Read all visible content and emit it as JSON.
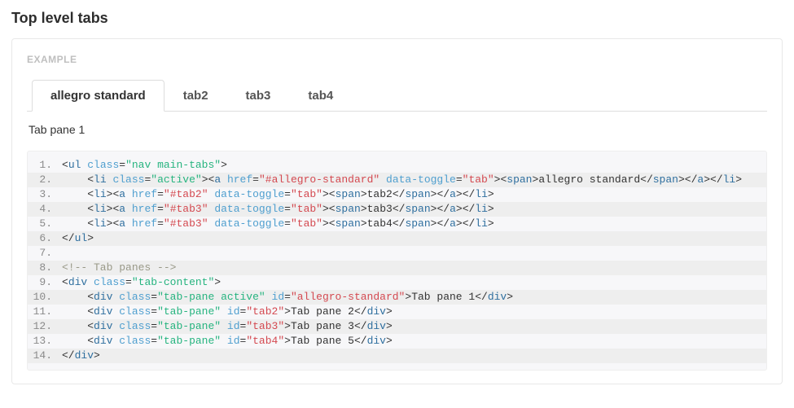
{
  "section": {
    "title": "Top level tabs"
  },
  "example": {
    "label": "EXAMPLE"
  },
  "tabs": {
    "items": [
      {
        "label": "allegro standard",
        "active": true
      },
      {
        "label": "tab2",
        "active": false
      },
      {
        "label": "tab3",
        "active": false
      },
      {
        "label": "tab4",
        "active": false
      }
    ],
    "pane_content": "Tab pane 1"
  },
  "code": {
    "lines": [
      {
        "n": "1.",
        "hl": false,
        "tokens": [
          {
            "t": "punc",
            "v": "<"
          },
          {
            "t": "tag",
            "v": "ul"
          },
          {
            "t": "txt",
            "v": " "
          },
          {
            "t": "attr",
            "v": "class"
          },
          {
            "t": "punc",
            "v": "="
          },
          {
            "t": "str2",
            "v": "\"nav main-tabs\""
          },
          {
            "t": "punc",
            "v": ">"
          }
        ]
      },
      {
        "n": "2.",
        "hl": true,
        "indent": 4,
        "tokens": [
          {
            "t": "punc",
            "v": "<"
          },
          {
            "t": "tag",
            "v": "li"
          },
          {
            "t": "txt",
            "v": " "
          },
          {
            "t": "attr",
            "v": "class"
          },
          {
            "t": "punc",
            "v": "="
          },
          {
            "t": "str2",
            "v": "\"active\""
          },
          {
            "t": "punc",
            "v": "><"
          },
          {
            "t": "tag",
            "v": "a"
          },
          {
            "t": "txt",
            "v": " "
          },
          {
            "t": "attr",
            "v": "href"
          },
          {
            "t": "punc",
            "v": "="
          },
          {
            "t": "str",
            "v": "\"#allegro-standard\""
          },
          {
            "t": "txt",
            "v": " "
          },
          {
            "t": "attr",
            "v": "data-toggle"
          },
          {
            "t": "punc",
            "v": "="
          },
          {
            "t": "str",
            "v": "\"tab\""
          },
          {
            "t": "punc",
            "v": "><"
          },
          {
            "t": "tag",
            "v": "span"
          },
          {
            "t": "punc",
            "v": ">"
          },
          {
            "t": "txt",
            "v": "allegro standard"
          },
          {
            "t": "punc",
            "v": "</"
          },
          {
            "t": "tag",
            "v": "span"
          },
          {
            "t": "punc",
            "v": "></"
          },
          {
            "t": "tag",
            "v": "a"
          },
          {
            "t": "punc",
            "v": "></"
          },
          {
            "t": "tag",
            "v": "li"
          },
          {
            "t": "punc",
            "v": ">"
          }
        ]
      },
      {
        "n": "3.",
        "hl": false,
        "indent": 4,
        "tokens": [
          {
            "t": "punc",
            "v": "<"
          },
          {
            "t": "tag",
            "v": "li"
          },
          {
            "t": "punc",
            "v": "><"
          },
          {
            "t": "tag",
            "v": "a"
          },
          {
            "t": "txt",
            "v": " "
          },
          {
            "t": "attr",
            "v": "href"
          },
          {
            "t": "punc",
            "v": "="
          },
          {
            "t": "str",
            "v": "\"#tab2\""
          },
          {
            "t": "txt",
            "v": " "
          },
          {
            "t": "attr",
            "v": "data-toggle"
          },
          {
            "t": "punc",
            "v": "="
          },
          {
            "t": "str",
            "v": "\"tab\""
          },
          {
            "t": "punc",
            "v": "><"
          },
          {
            "t": "tag",
            "v": "span"
          },
          {
            "t": "punc",
            "v": ">"
          },
          {
            "t": "txt",
            "v": "tab2"
          },
          {
            "t": "punc",
            "v": "</"
          },
          {
            "t": "tag",
            "v": "span"
          },
          {
            "t": "punc",
            "v": "></"
          },
          {
            "t": "tag",
            "v": "a"
          },
          {
            "t": "punc",
            "v": "></"
          },
          {
            "t": "tag",
            "v": "li"
          },
          {
            "t": "punc",
            "v": ">"
          }
        ]
      },
      {
        "n": "4.",
        "hl": true,
        "indent": 4,
        "tokens": [
          {
            "t": "punc",
            "v": "<"
          },
          {
            "t": "tag",
            "v": "li"
          },
          {
            "t": "punc",
            "v": "><"
          },
          {
            "t": "tag",
            "v": "a"
          },
          {
            "t": "txt",
            "v": " "
          },
          {
            "t": "attr",
            "v": "href"
          },
          {
            "t": "punc",
            "v": "="
          },
          {
            "t": "str",
            "v": "\"#tab3\""
          },
          {
            "t": "txt",
            "v": " "
          },
          {
            "t": "attr",
            "v": "data-toggle"
          },
          {
            "t": "punc",
            "v": "="
          },
          {
            "t": "str",
            "v": "\"tab\""
          },
          {
            "t": "punc",
            "v": "><"
          },
          {
            "t": "tag",
            "v": "span"
          },
          {
            "t": "punc",
            "v": ">"
          },
          {
            "t": "txt",
            "v": "tab3"
          },
          {
            "t": "punc",
            "v": "</"
          },
          {
            "t": "tag",
            "v": "span"
          },
          {
            "t": "punc",
            "v": "></"
          },
          {
            "t": "tag",
            "v": "a"
          },
          {
            "t": "punc",
            "v": "></"
          },
          {
            "t": "tag",
            "v": "li"
          },
          {
            "t": "punc",
            "v": ">"
          }
        ]
      },
      {
        "n": "5.",
        "hl": false,
        "indent": 4,
        "tokens": [
          {
            "t": "punc",
            "v": "<"
          },
          {
            "t": "tag",
            "v": "li"
          },
          {
            "t": "punc",
            "v": "><"
          },
          {
            "t": "tag",
            "v": "a"
          },
          {
            "t": "txt",
            "v": " "
          },
          {
            "t": "attr",
            "v": "href"
          },
          {
            "t": "punc",
            "v": "="
          },
          {
            "t": "str",
            "v": "\"#tab3\""
          },
          {
            "t": "txt",
            "v": " "
          },
          {
            "t": "attr",
            "v": "data-toggle"
          },
          {
            "t": "punc",
            "v": "="
          },
          {
            "t": "str",
            "v": "\"tab\""
          },
          {
            "t": "punc",
            "v": "><"
          },
          {
            "t": "tag",
            "v": "span"
          },
          {
            "t": "punc",
            "v": ">"
          },
          {
            "t": "txt",
            "v": "tab4"
          },
          {
            "t": "punc",
            "v": "</"
          },
          {
            "t": "tag",
            "v": "span"
          },
          {
            "t": "punc",
            "v": "></"
          },
          {
            "t": "tag",
            "v": "a"
          },
          {
            "t": "punc",
            "v": "></"
          },
          {
            "t": "tag",
            "v": "li"
          },
          {
            "t": "punc",
            "v": ">"
          }
        ]
      },
      {
        "n": "6.",
        "hl": true,
        "tokens": [
          {
            "t": "punc",
            "v": "</"
          },
          {
            "t": "tag",
            "v": "ul"
          },
          {
            "t": "punc",
            "v": ">"
          }
        ]
      },
      {
        "n": "7.",
        "hl": false,
        "tokens": []
      },
      {
        "n": "8.",
        "hl": true,
        "tokens": [
          {
            "t": "cmt",
            "v": "<!-- Tab panes -->"
          }
        ]
      },
      {
        "n": "9.",
        "hl": false,
        "tokens": [
          {
            "t": "punc",
            "v": "<"
          },
          {
            "t": "tag",
            "v": "div"
          },
          {
            "t": "txt",
            "v": " "
          },
          {
            "t": "attr",
            "v": "class"
          },
          {
            "t": "punc",
            "v": "="
          },
          {
            "t": "str2",
            "v": "\"tab-content\""
          },
          {
            "t": "punc",
            "v": ">"
          }
        ]
      },
      {
        "n": "10.",
        "hl": true,
        "indent": 4,
        "tokens": [
          {
            "t": "punc",
            "v": "<"
          },
          {
            "t": "tag",
            "v": "div"
          },
          {
            "t": "txt",
            "v": " "
          },
          {
            "t": "attr",
            "v": "class"
          },
          {
            "t": "punc",
            "v": "="
          },
          {
            "t": "str2",
            "v": "\"tab-pane active\""
          },
          {
            "t": "txt",
            "v": " "
          },
          {
            "t": "attr",
            "v": "id"
          },
          {
            "t": "punc",
            "v": "="
          },
          {
            "t": "str",
            "v": "\"allegro-standard\""
          },
          {
            "t": "punc",
            "v": ">"
          },
          {
            "t": "txt",
            "v": "Tab pane 1"
          },
          {
            "t": "punc",
            "v": "</"
          },
          {
            "t": "tag",
            "v": "div"
          },
          {
            "t": "punc",
            "v": ">"
          }
        ]
      },
      {
        "n": "11.",
        "hl": false,
        "indent": 4,
        "tokens": [
          {
            "t": "punc",
            "v": "<"
          },
          {
            "t": "tag",
            "v": "div"
          },
          {
            "t": "txt",
            "v": " "
          },
          {
            "t": "attr",
            "v": "class"
          },
          {
            "t": "punc",
            "v": "="
          },
          {
            "t": "str2",
            "v": "\"tab-pane\""
          },
          {
            "t": "txt",
            "v": " "
          },
          {
            "t": "attr",
            "v": "id"
          },
          {
            "t": "punc",
            "v": "="
          },
          {
            "t": "str",
            "v": "\"tab2\""
          },
          {
            "t": "punc",
            "v": ">"
          },
          {
            "t": "txt",
            "v": "Tab pane 2"
          },
          {
            "t": "punc",
            "v": "</"
          },
          {
            "t": "tag",
            "v": "div"
          },
          {
            "t": "punc",
            "v": ">"
          }
        ]
      },
      {
        "n": "12.",
        "hl": true,
        "indent": 4,
        "tokens": [
          {
            "t": "punc",
            "v": "<"
          },
          {
            "t": "tag",
            "v": "div"
          },
          {
            "t": "txt",
            "v": " "
          },
          {
            "t": "attr",
            "v": "class"
          },
          {
            "t": "punc",
            "v": "="
          },
          {
            "t": "str2",
            "v": "\"tab-pane\""
          },
          {
            "t": "txt",
            "v": " "
          },
          {
            "t": "attr",
            "v": "id"
          },
          {
            "t": "punc",
            "v": "="
          },
          {
            "t": "str",
            "v": "\"tab3\""
          },
          {
            "t": "punc",
            "v": ">"
          },
          {
            "t": "txt",
            "v": "Tab pane 3"
          },
          {
            "t": "punc",
            "v": "</"
          },
          {
            "t": "tag",
            "v": "div"
          },
          {
            "t": "punc",
            "v": ">"
          }
        ]
      },
      {
        "n": "13.",
        "hl": false,
        "indent": 4,
        "tokens": [
          {
            "t": "punc",
            "v": "<"
          },
          {
            "t": "tag",
            "v": "div"
          },
          {
            "t": "txt",
            "v": " "
          },
          {
            "t": "attr",
            "v": "class"
          },
          {
            "t": "punc",
            "v": "="
          },
          {
            "t": "str2",
            "v": "\"tab-pane\""
          },
          {
            "t": "txt",
            "v": " "
          },
          {
            "t": "attr",
            "v": "id"
          },
          {
            "t": "punc",
            "v": "="
          },
          {
            "t": "str",
            "v": "\"tab4\""
          },
          {
            "t": "punc",
            "v": ">"
          },
          {
            "t": "txt",
            "v": "Tab pane 5"
          },
          {
            "t": "punc",
            "v": "</"
          },
          {
            "t": "tag",
            "v": "div"
          },
          {
            "t": "punc",
            "v": ">"
          }
        ]
      },
      {
        "n": "14.",
        "hl": true,
        "tokens": [
          {
            "t": "punc",
            "v": "</"
          },
          {
            "t": "tag",
            "v": "div"
          },
          {
            "t": "punc",
            "v": ">"
          }
        ]
      }
    ]
  }
}
